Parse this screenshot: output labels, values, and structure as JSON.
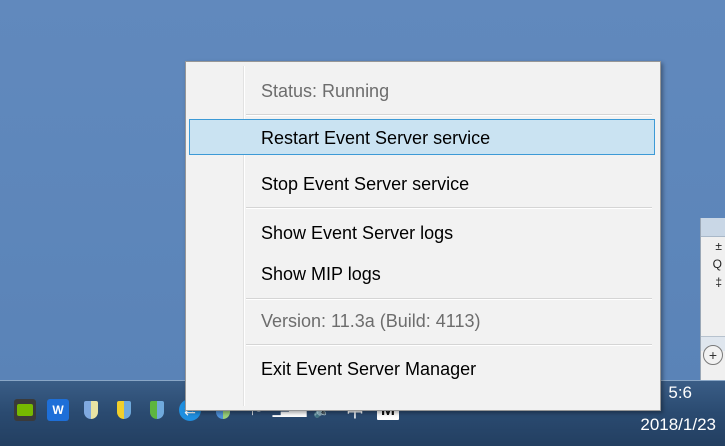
{
  "context_menu": {
    "status": "Status: Running",
    "restart": "Restart Event Server service",
    "stop": "Stop Event Server service",
    "show_event_logs": "Show Event Server logs",
    "show_mip_logs": "Show MIP logs",
    "version": "Version: 11.3a (Build: 4113)",
    "exit": "Exit Event Server Manager"
  },
  "side_window": {
    "glyph_up": "±",
    "glyph_mid": "Q",
    "glyph_down": "‡",
    "expand_label": "+"
  },
  "tray": {
    "wave_label": "W",
    "ime_label": "中",
    "m_label": "M"
  },
  "clock": {
    "time_fragment": "5:6",
    "date": "2018/1/23"
  }
}
